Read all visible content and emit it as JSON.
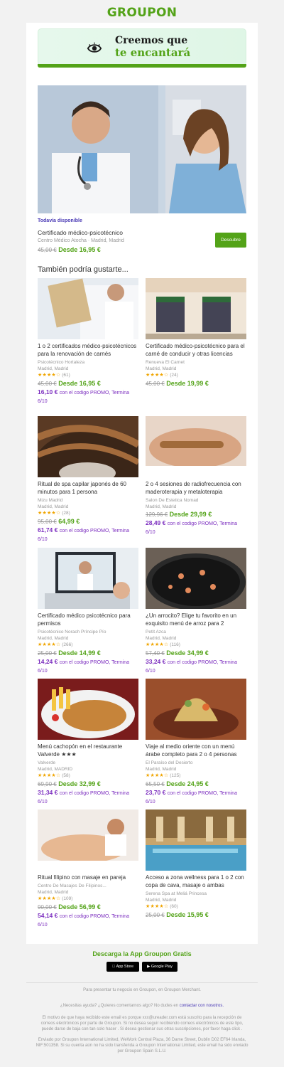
{
  "brand": {
    "logo": "GROUPON",
    "green": "#53a318",
    "purple": "#7b2dbf"
  },
  "banner": {
    "line1": "Creemos que",
    "line2": "te encantará",
    "icon": "eye-icon"
  },
  "hero": {
    "tag": "Todavía disponible",
    "title": "Certificado médico-psicotécnico",
    "merchant": "Centro Médico Atocha",
    "location": "Madrid, Madrid",
    "old_price": "45,00 €",
    "price": "Desde 16,95 €",
    "button": "Descubre"
  },
  "also_title": "También podría gustarte...",
  "deals": [
    {
      "title": "1 o 2 certificados médico-psicotécnicos para la renovación de carnés",
      "merchant": "Psicotécnico Hortaleza",
      "location": "Madrid, Madrid",
      "stars": "★★★★☆",
      "reviews": "(61)",
      "old_price": "45,00 €",
      "price": "Desde 16,95 €",
      "promo_price": "16,10 €",
      "promo_text": "con el codigo PROMO, Termina 6/10"
    },
    {
      "title": "Certificado médico-psicotécnico para el carné de conducir y otras licencias",
      "merchant": "Renueva El Carnet",
      "location": "Madrid, Madrid",
      "stars": "★★★★☆",
      "reviews": "(24)",
      "old_price": "45,00 €",
      "price": "Desde 19,99 €",
      "promo_price": "",
      "promo_text": ""
    },
    {
      "title": "Ritual de spa capilar japonés de 60 minutos para 1 persona",
      "merchant": "Mizu Madrid",
      "location": "Madrid, Madrid",
      "stars": "★★★★☆",
      "reviews": "(28)",
      "old_price": "95,00 €",
      "price": "64,99 €",
      "promo_price": "61,74 €",
      "promo_text": "con el codigo PROMO, Termina 6/10"
    },
    {
      "title": "2 o 4 sesiones de radiofrecuencia con maderoterapia y metaloterapia",
      "merchant": "Salon De Estetica Nomad",
      "location": "Madrid, Madrid",
      "stars": "",
      "reviews": "",
      "old_price": "129,96 €",
      "price": "Desde 29,99 €",
      "promo_price": "28,49 €",
      "promo_text": "con el codigo PROMO, Termina 6/10"
    },
    {
      "title": "Certificado médico psicotécnico para permisos",
      "merchant": "Psicotécnico Norach Príncipe Pío",
      "location": "Madrid, Madrid",
      "stars": "★★★★☆",
      "reviews": "(266)",
      "old_price": "25,00 €",
      "price": "Desde 14,99 €",
      "promo_price": "14,24 €",
      "promo_text": "con el codigo PROMO, Termina 6/10"
    },
    {
      "title": "¿Un arrocito? Elige tu favorito en un exquisito menú de arroz para 2",
      "merchant": "Petit Azca",
      "location": "Madrid, Madrid",
      "stars": "★★★★☆",
      "reviews": "(116)",
      "old_price": "57,40 €",
      "price": "Desde 34,99 €",
      "promo_price": "33,24 €",
      "promo_text": "con el codigo PROMO, Termina 6/10"
    },
    {
      "title": "Menú cachopón en el restaurante Valverde ★★★",
      "merchant": "Valverde",
      "location": "Madrid, MADRID",
      "stars": "★★★★☆",
      "reviews": "(58)",
      "old_price": "69,90 €",
      "price": "Desde 32,99 €",
      "promo_price": "31,34 €",
      "promo_text": "con el codigo PROMO, Termina 6/10"
    },
    {
      "title": "Viaje al medio oriente con un menú árabe completo para 2 o 4 personas",
      "merchant": "El Paraíso del Desierto",
      "location": "Madrid, Madrid",
      "stars": "★★★★☆",
      "reviews": "(125)",
      "old_price": "65,50 €",
      "price": "Desde 24,95 €",
      "promo_price": "23,70 €",
      "promo_text": "con el codigo PROMO, Termina 6/10"
    },
    {
      "title": "Ritual filipino con masaje en pareja",
      "merchant": "Centro De Masajes De Filipinos...",
      "location": "Madrid, Madrid",
      "stars": "★★★★☆",
      "reviews": "(109)",
      "old_price": "90,00 €",
      "price": "Desde 56,99 €",
      "promo_price": "54,14 €",
      "promo_text": "con el codigo PROMO, Termina 6/10"
    },
    {
      "title": "Acceso a zona wellness para 1 o 2 con copa de cava, masaje o ambas",
      "merchant": "Serena Spa at Meliá Princesa",
      "location": "Madrid, Madrid",
      "stars": "★★★★☆",
      "reviews": "(60)",
      "old_price": "25,00 €",
      "price": "Desde 15,95 €",
      "promo_price": "",
      "promo_text": ""
    }
  ],
  "footer": {
    "app_title": "Descarga la App Groupon Gratis",
    "app_store": "App Store",
    "google_play": "Google Play",
    "merchant_line": "Para presentar tu negocio en Groupon, en Groupon Merchant.",
    "help_text": "¿Necesitas ayuda? ¿Quieres comentarnos algo? No dudes en",
    "help_link": "contactar con nosotros.",
    "reason": "El motivo de que haya recibido este email es porque xxx@ureader.com está suscrito para la recepción de correos electrónicos por parte de Groupon. Si no desea seguir recibiendo correos electrónicos de este tipo, puede darse de baja con tan solo hacer . Si desea gestionar sus otras suscripciones, por favor haga click .",
    "address": "Enviado por Groupon International Limited, WeWork Central Plaza, 36 Dame Street, Dublin D02 EF64 Irlanda, NIF:501358. Si su cuenta aún no ha sido transferida a Groupon International Limited, este email ha sido enviado por Groupon Spain S.L.U."
  }
}
